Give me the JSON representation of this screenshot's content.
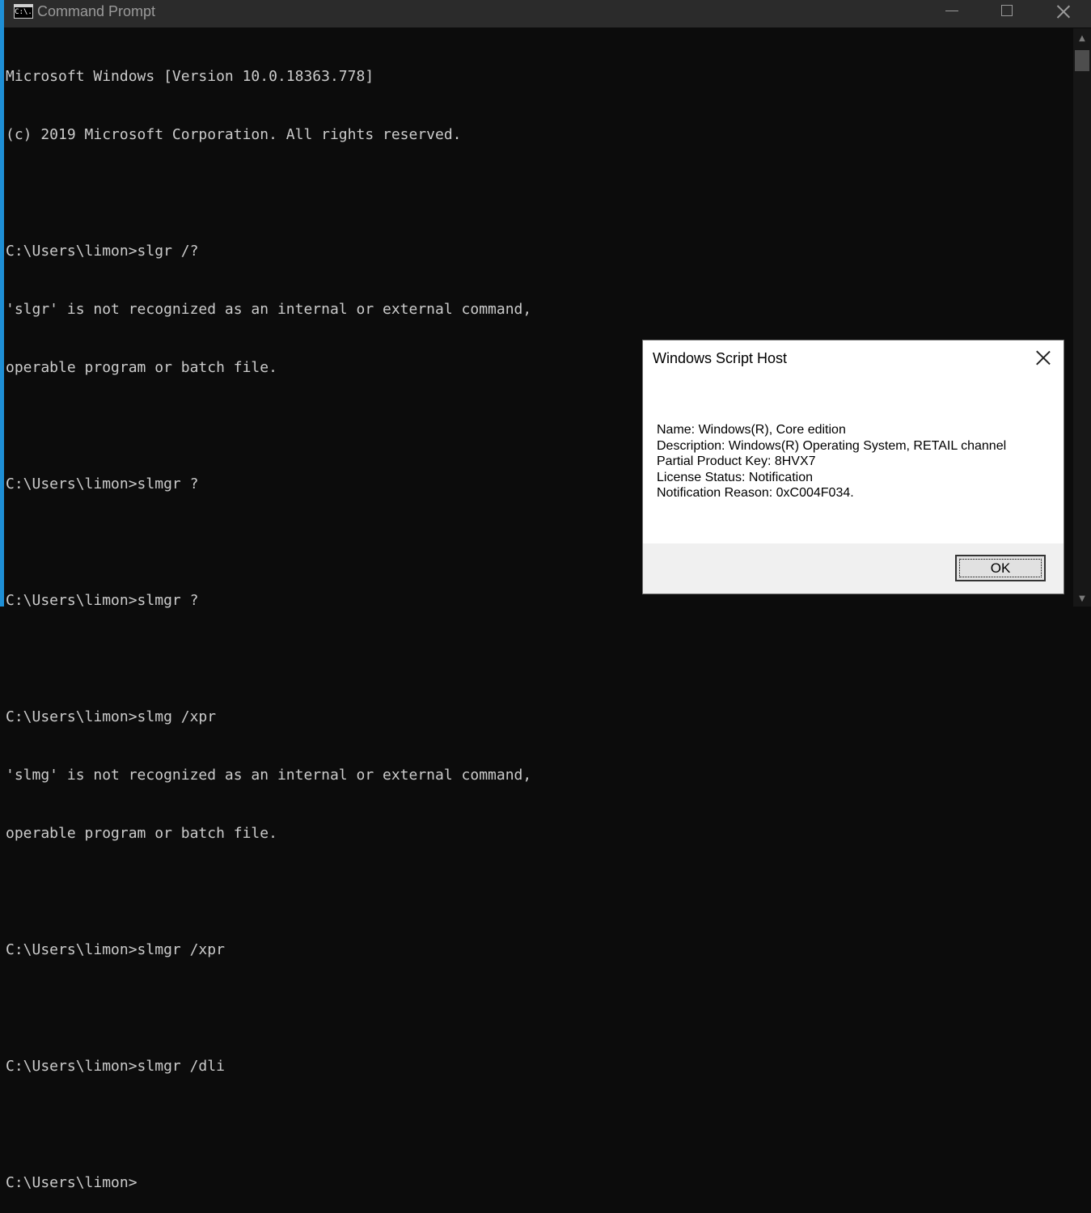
{
  "window": {
    "title": "Command Prompt",
    "icon": "C:\\.",
    "controls": [
      "minimize-icon",
      "maximize-icon",
      "close-icon"
    ]
  },
  "console": {
    "lines": [
      "Microsoft Windows [Version 10.0.18363.778]",
      "(c) 2019 Microsoft Corporation. All rights reserved.",
      "",
      "C:\\Users\\limon>slgr /?",
      "'slgr' is not recognized as an internal or external command,",
      "operable program or batch file.",
      "",
      "C:\\Users\\limon>slmgr ?",
      "",
      "C:\\Users\\limon>slmgr ?",
      "",
      "C:\\Users\\limon>slmg /xpr",
      "'slmg' is not recognized as an internal or external command,",
      "operable program or batch file.",
      "",
      "C:\\Users\\limon>slmgr /xpr",
      "",
      "C:\\Users\\limon>slmgr /dli",
      "",
      "C:\\Users\\limon>"
    ]
  },
  "dialog": {
    "title": "Windows Script Host",
    "lines": [
      "Name: Windows(R), Core edition",
      "Description: Windows(R) Operating System, RETAIL channel",
      "Partial Product Key: 8HVX7",
      "License Status: Notification",
      "Notification Reason: 0xC004F034."
    ],
    "ok_label": "OK"
  },
  "colors": {
    "console_bg": "#0c0c0c",
    "console_text": "#cccccc",
    "titlebar_bg": "#2b2b2b",
    "accent_border": "#1e8fd6"
  }
}
